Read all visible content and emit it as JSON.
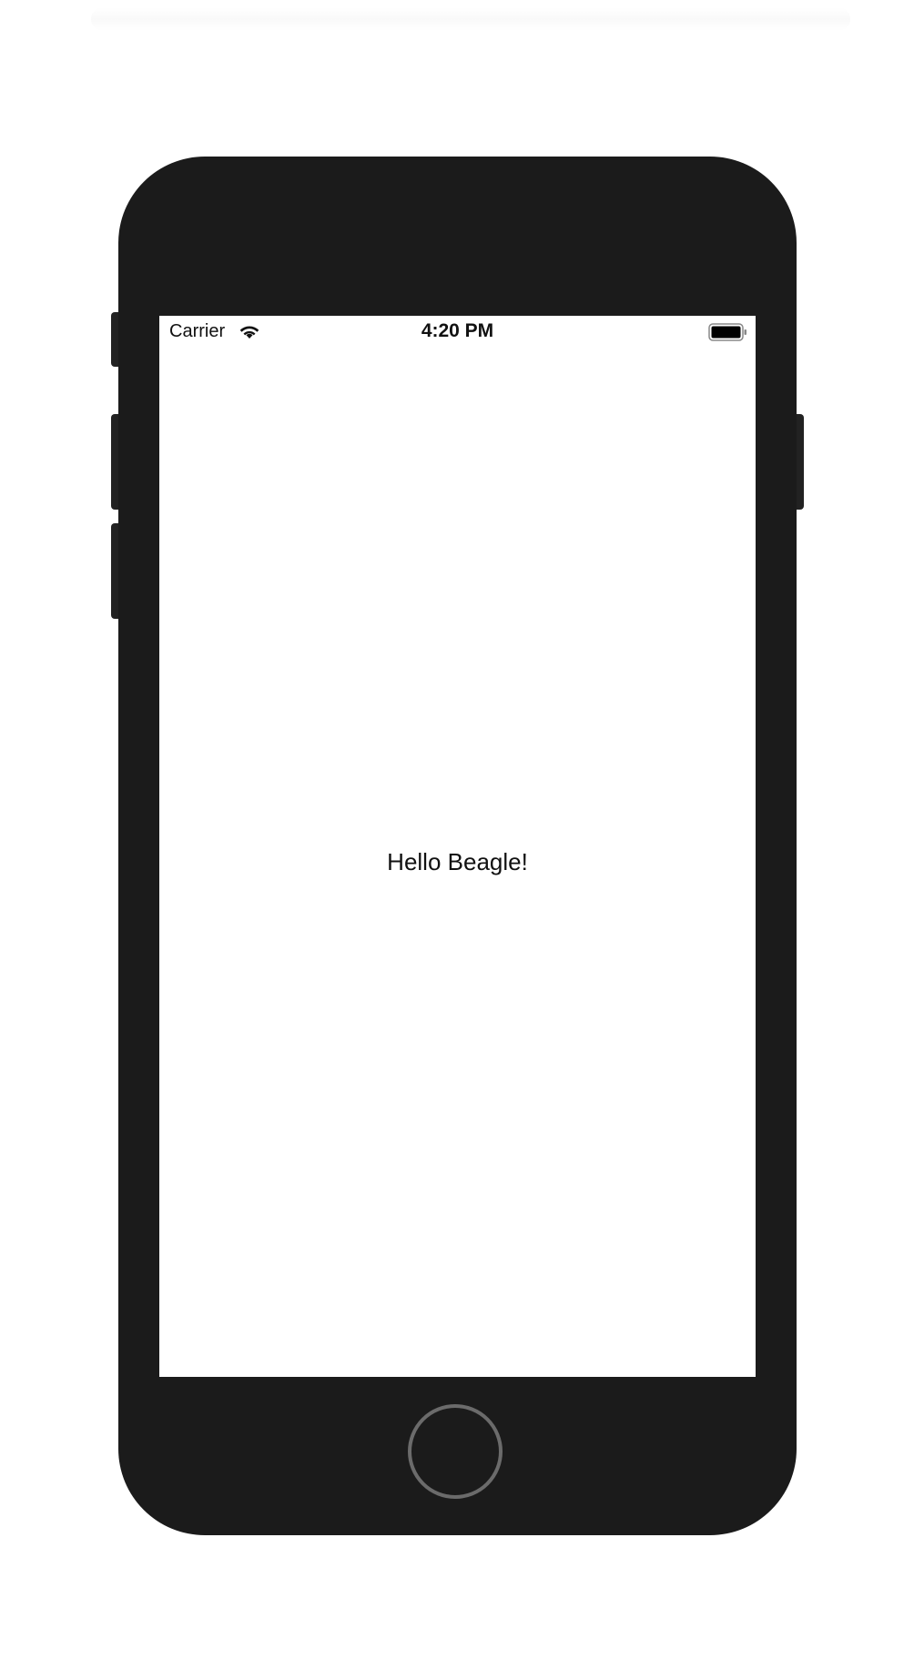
{
  "status_bar": {
    "carrier": "Carrier",
    "time": "4:20 PM",
    "wifi_icon": "wifi-icon",
    "battery_icon": "battery-icon"
  },
  "screen": {
    "text": "Hello Beagle!"
  },
  "device": {
    "frame_color": "#1b1b1b",
    "home_button_ring_color": "#6b6b6b"
  }
}
